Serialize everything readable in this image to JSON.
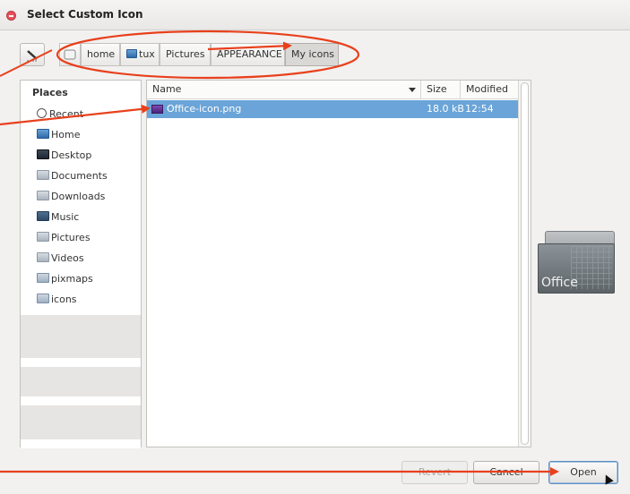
{
  "window": {
    "title": "Select Custom Icon"
  },
  "pathbar": {
    "crumbs": [
      {
        "label": "home"
      },
      {
        "label": "tux"
      },
      {
        "label": "Pictures"
      },
      {
        "label": "APPEARANCE"
      },
      {
        "label": "My icons"
      }
    ]
  },
  "places": {
    "header": "Places",
    "items": [
      {
        "label": "Recent",
        "icon": "recent-icon"
      },
      {
        "label": "Home",
        "icon": "home-folder-icon"
      },
      {
        "label": "Desktop",
        "icon": "desktop-icon"
      },
      {
        "label": "Documents",
        "icon": "documents-folder-icon"
      },
      {
        "label": "Downloads",
        "icon": "downloads-folder-icon"
      },
      {
        "label": "Music",
        "icon": "music-folder-icon"
      },
      {
        "label": "Pictures",
        "icon": "pictures-folder-icon"
      },
      {
        "label": "Videos",
        "icon": "videos-folder-icon"
      },
      {
        "label": "pixmaps",
        "icon": "folder-icon"
      },
      {
        "label": "icons",
        "icon": "folder-icon"
      }
    ]
  },
  "files": {
    "columns": {
      "name": "Name",
      "size": "Size",
      "modified": "Modified"
    },
    "rows": [
      {
        "name": "Office-icon.png",
        "size": "18.0 kB",
        "modified": "12:54",
        "selected": true
      }
    ]
  },
  "preview": {
    "label": "Office"
  },
  "buttons": {
    "revert": "Revert",
    "cancel": "Cancel",
    "open": "Open"
  },
  "colors": {
    "selection": "#6aa4d8",
    "annotation": "#e8401c"
  }
}
